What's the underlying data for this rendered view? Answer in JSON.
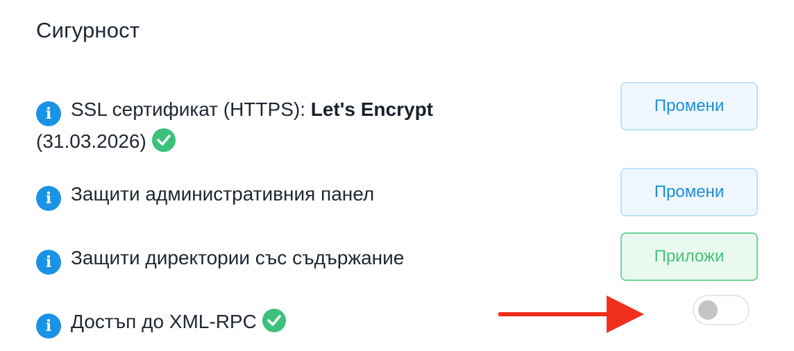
{
  "section": {
    "title": "Сигурност"
  },
  "rows": [
    {
      "label_prefix": "SSL сертификат (HTTPS): ",
      "label_bold": "Let's Encrypt",
      "label_suffix": " (31.03.2026)",
      "verified": true,
      "action": {
        "type": "button",
        "label": "Промени",
        "style": "blue"
      }
    },
    {
      "label": "Защити административния панел",
      "action": {
        "type": "button",
        "label": "Промени",
        "style": "blue"
      }
    },
    {
      "label": "Защити директории със съдържание",
      "action": {
        "type": "button",
        "label": "Приложи",
        "style": "green"
      }
    },
    {
      "label": "Достъп до XML-RPC",
      "verified": true,
      "action": {
        "type": "toggle",
        "state": "off"
      }
    }
  ],
  "icons": {
    "info": "info-icon",
    "check": "check-circle-icon",
    "annotation": "red-arrow-icon"
  },
  "colors": {
    "info_blue": "#1a93e6",
    "check_green": "#3cc17a",
    "button_blue_text": "#1b8fd8",
    "button_green_text": "#45c27a",
    "annotation_red": "#f0301c"
  }
}
